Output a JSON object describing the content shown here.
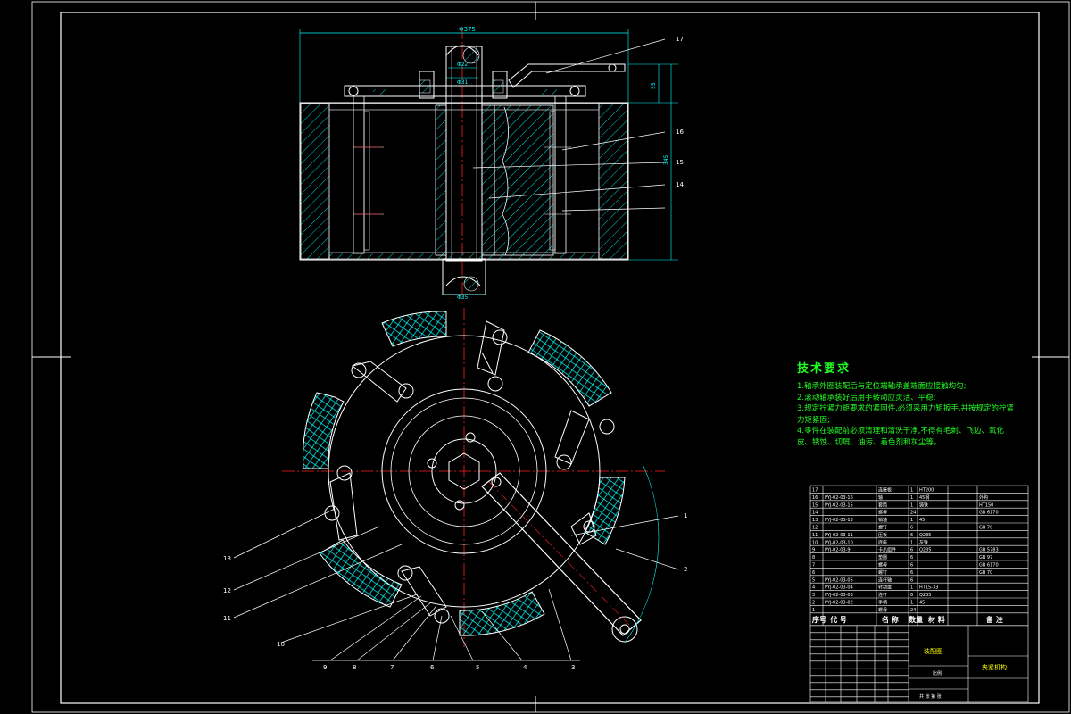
{
  "drawing": {
    "dim_top_width": "Φ375",
    "dim_upper_small": "Φ22",
    "dim_upper_small2": "Φ31",
    "dim_bottom": "Φ35",
    "dim_side_height": "345",
    "dim_side_small": "55",
    "callouts_top": [
      "17",
      "16",
      "15",
      "14"
    ],
    "callouts_right": [
      "1",
      "2"
    ],
    "callouts_left": [
      "13",
      "12",
      "11",
      "10"
    ],
    "callouts_bottom": [
      "9",
      "8",
      "7",
      "6",
      "5",
      "4",
      "3"
    ]
  },
  "tech_requirements": {
    "title": "技术要求",
    "lines": [
      "1.轴承外圈装配后与定位端轴承盖端面应接触均匀;",
      "2.滚动轴承装好后用手转动应灵活、平稳;",
      "3.规定拧紧力矩要求的紧固件,必须采用力矩扳手,并按规定的拧紧力矩紧固;",
      "4.零件在装配前必须清理和清洗干净,不得有毛刺、飞边、氧化皮、锈蚀、切屑、油污、着色剂和灰尘等。"
    ]
  },
  "bom": {
    "rows": [
      {
        "no": "17",
        "code": "",
        "name": "连接板",
        "qty": "1",
        "mat": "HT200",
        "note": ""
      },
      {
        "no": "16",
        "code": "PYJ-02-03-16",
        "name": "轴",
        "qty": "1",
        "mat": "45钢",
        "note": "外购"
      },
      {
        "no": "15",
        "code": "PYJ-02-03-15",
        "name": "套筒",
        "qty": "1",
        "mat": "铸铁",
        "note": "HT150"
      },
      {
        "no": "14",
        "code": "",
        "name": "螺母",
        "qty": "24",
        "mat": "",
        "note": "GB 6170"
      },
      {
        "no": "13",
        "code": "PYJ-02-03-13",
        "name": "销轴",
        "qty": "1",
        "mat": "45",
        "note": ""
      },
      {
        "no": "12",
        "code": "",
        "name": "螺钉",
        "qty": "6",
        "mat": "",
        "note": "GB 70"
      },
      {
        "no": "11",
        "code": "PYJ-02-03-11",
        "name": "压板",
        "qty": "6",
        "mat": "Q235",
        "note": ""
      },
      {
        "no": "10",
        "code": "PYJ-02-03-10",
        "name": "底座",
        "qty": "1",
        "mat": "灰铁",
        "note": ""
      },
      {
        "no": "9",
        "code": "PYJ-02-03-9",
        "name": "卡爪组件",
        "qty": "6",
        "mat": "Q235",
        "note": "GB 5783"
      },
      {
        "no": "8",
        "code": "",
        "name": "垫圈",
        "qty": "6",
        "mat": "",
        "note": "GB 97"
      },
      {
        "no": "7",
        "code": "",
        "name": "螺母",
        "qty": "6",
        "mat": "",
        "note": "GB 6170"
      },
      {
        "no": "6",
        "code": "",
        "name": "螺钉",
        "qty": "6",
        "mat": "",
        "note": "GB 70"
      },
      {
        "no": "5",
        "code": "PYJ-02-03-05",
        "name": "连杆轴",
        "qty": "6",
        "mat": "",
        "note": ""
      },
      {
        "no": "4",
        "code": "PYJ-02-03-04",
        "name": "转动盘",
        "qty": "1",
        "mat": "HT15-33",
        "note": ""
      },
      {
        "no": "3",
        "code": "PYJ-02-03-03",
        "name": "连杆",
        "qty": "6",
        "mat": "Q235",
        "note": ""
      },
      {
        "no": "2",
        "code": "PYJ-02-03-02",
        "name": "手柄",
        "qty": "1",
        "mat": "45",
        "note": ""
      },
      {
        "no": "1",
        "code": "",
        "name": "螺母",
        "qty": "24",
        "mat": "",
        "note": ""
      }
    ],
    "header": {
      "no": "序号",
      "code": "代 号",
      "name": "名 称",
      "qty": "数量",
      "mat": "材 料",
      "note": "备 注"
    },
    "title_block": {
      "assembly": "装配图",
      "drawing_name": "夹紧机构",
      "scale_label": "比例",
      "sheet_label": "共 张 第 张"
    }
  },
  "colors": {
    "frame": "#ffffff",
    "part": "#ffffff",
    "dim": "#00ffff",
    "center": "#ff2020",
    "hatch": "#00ffff",
    "text": "#22ff22",
    "leader": "#ffffff"
  }
}
